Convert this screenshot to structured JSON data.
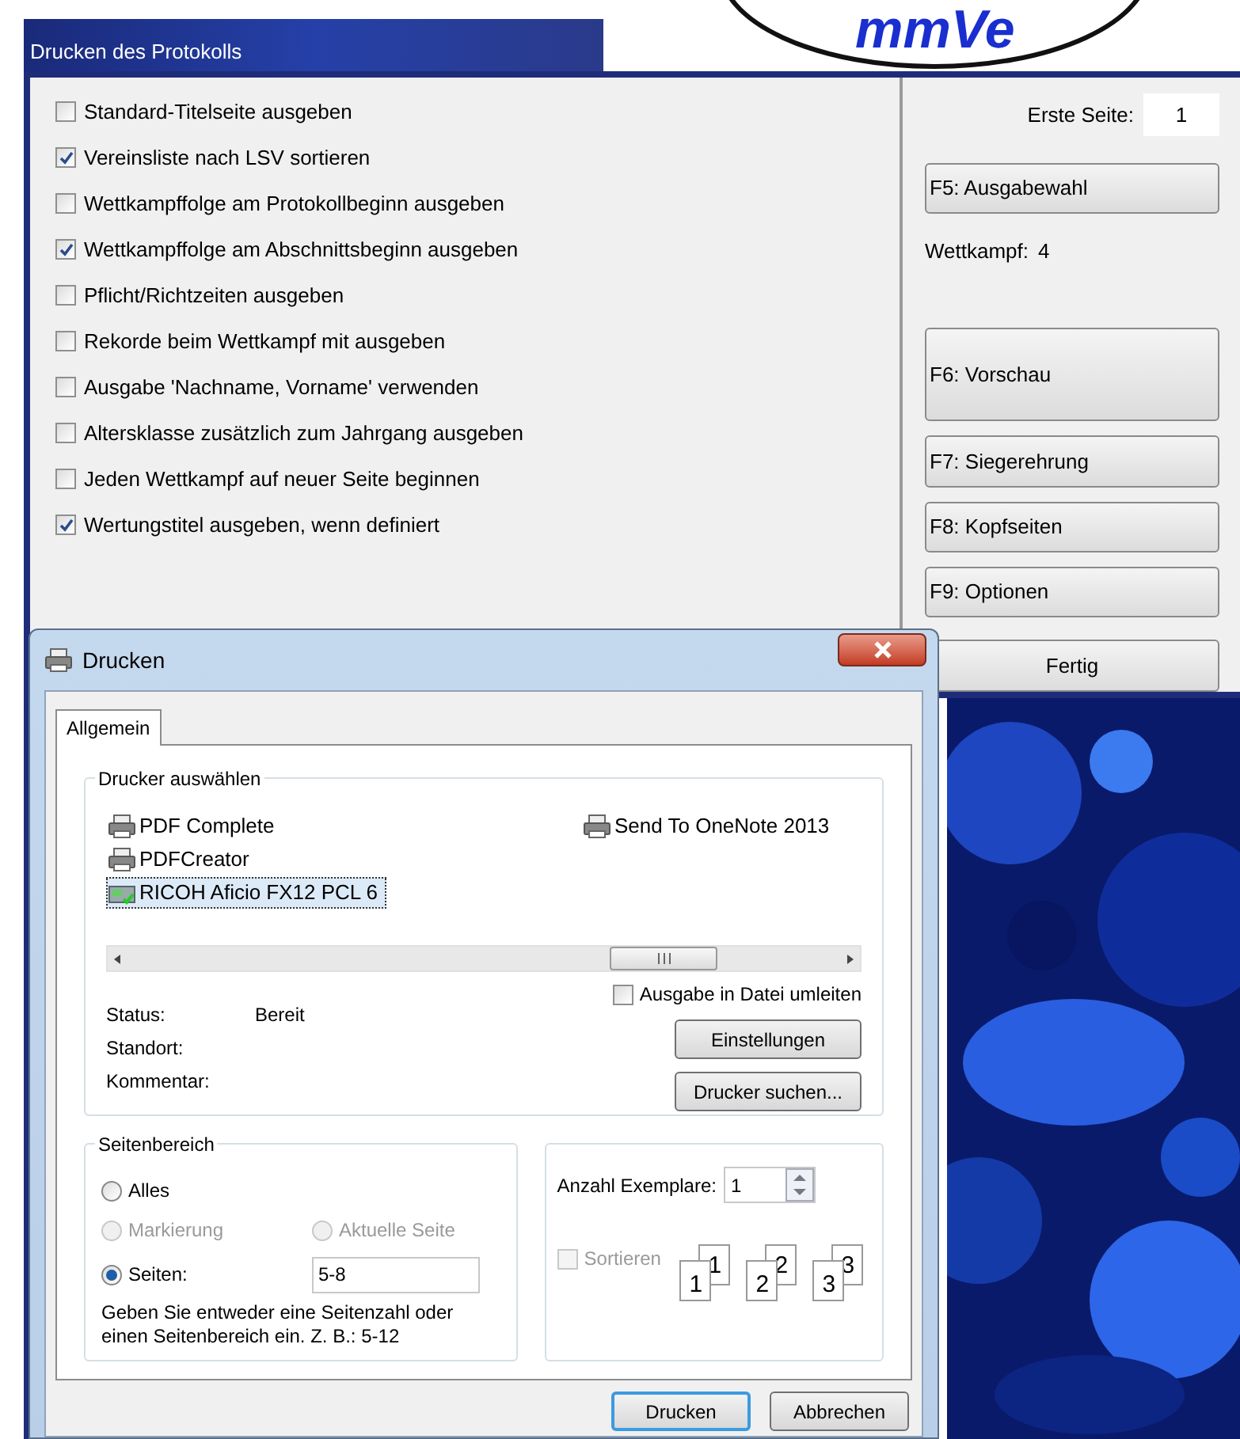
{
  "logo": {
    "text": "mmVe"
  },
  "main_window": {
    "title": "Drucken des Protokolls",
    "options": [
      {
        "label": "Standard-Titelseite ausgeben",
        "checked": false
      },
      {
        "label": "Vereinsliste nach LSV sortieren",
        "checked": true
      },
      {
        "label": "Wettkampffolge am Protokollbeginn ausgeben",
        "checked": false
      },
      {
        "label": "Wettkampffolge am Abschnittsbeginn ausgeben",
        "checked": true
      },
      {
        "label": "Pflicht/Richtzeiten ausgeben",
        "checked": false
      },
      {
        "label": "Rekorde beim Wettkampf mit ausgeben",
        "checked": false
      },
      {
        "label": "Ausgabe 'Nachname, Vorname' verwenden",
        "checked": false
      },
      {
        "label": "Altersklasse zusätzlich zum Jahrgang ausgeben",
        "checked": false
      },
      {
        "label": "Jeden Wettkampf auf neuer Seite beginnen",
        "checked": false
      },
      {
        "label": "Wertungstitel ausgeben, wenn definiert",
        "checked": true
      }
    ],
    "sidebar": [
      {
        "kind": "field",
        "label": "Erste Seite:",
        "value": "1"
      },
      {
        "kind": "button",
        "label": "F5: Ausgabewahl"
      },
      {
        "kind": "info",
        "label": "Wettkampf:",
        "value": "4"
      },
      {
        "kind": "tall_button",
        "label": "F6: Vorschau"
      },
      {
        "kind": "button",
        "label": "F7: Siegerehrung"
      },
      {
        "kind": "button",
        "label": "F8: Kopfseiten"
      },
      {
        "kind": "button",
        "label": "F9: Optionen"
      },
      {
        "kind": "center_button",
        "label": "Fertig"
      }
    ]
  },
  "print_dialog": {
    "title": "Drucken",
    "tabs": [
      {
        "label": "Allgemein",
        "selected": true
      }
    ],
    "printer_group": {
      "title": "Drucker auswählen",
      "printers": [
        {
          "name": "PDF Complete",
          "selected": false,
          "kind": "printer"
        },
        {
          "name": "PDFCreator",
          "selected": false,
          "kind": "printer"
        },
        {
          "name": "RICOH Aficio FX12 PCL 6",
          "selected": true,
          "kind": "fax"
        },
        {
          "name": "Send To OneNote 2013",
          "selected": false,
          "kind": "printer"
        }
      ],
      "status": [
        {
          "label": "Status:",
          "value": "Bereit"
        },
        {
          "label": "Standort:"
        },
        {
          "label": "Kommentar:"
        }
      ],
      "print_to_file": {
        "label": "Ausgabe in Datei umleiten",
        "checked": false
      },
      "buttons": [
        "Einstellungen",
        "Drucker suchen..."
      ]
    },
    "page_range": {
      "title": "Seitenbereich",
      "options": [
        {
          "label": "Alles",
          "selected": false,
          "disabled": false
        },
        {
          "label": "Markierung",
          "selected": false,
          "disabled": true
        },
        {
          "label": "Aktuelle Seite",
          "selected": false,
          "disabled": true
        },
        {
          "label": "Seiten:",
          "selected": true,
          "disabled": false
        }
      ],
      "pages_value": "5-8",
      "hint": "Geben Sie entweder eine Seitenzahl oder einen Seitenbereich ein. Z. B.: 5-12"
    },
    "copies": {
      "label": "Anzahl Exemplare:",
      "value": "1",
      "collate": {
        "label": "Sortieren",
        "checked": false,
        "disabled": true
      },
      "collate_sets": [
        {
          "back": "1",
          "front": "1"
        },
        {
          "back": "2",
          "front": "2"
        },
        {
          "back": "3",
          "front": "3"
        }
      ]
    },
    "actions": [
      {
        "label": "Drucken",
        "default": true
      },
      {
        "label": "Abbrechen",
        "default": false
      }
    ]
  }
}
